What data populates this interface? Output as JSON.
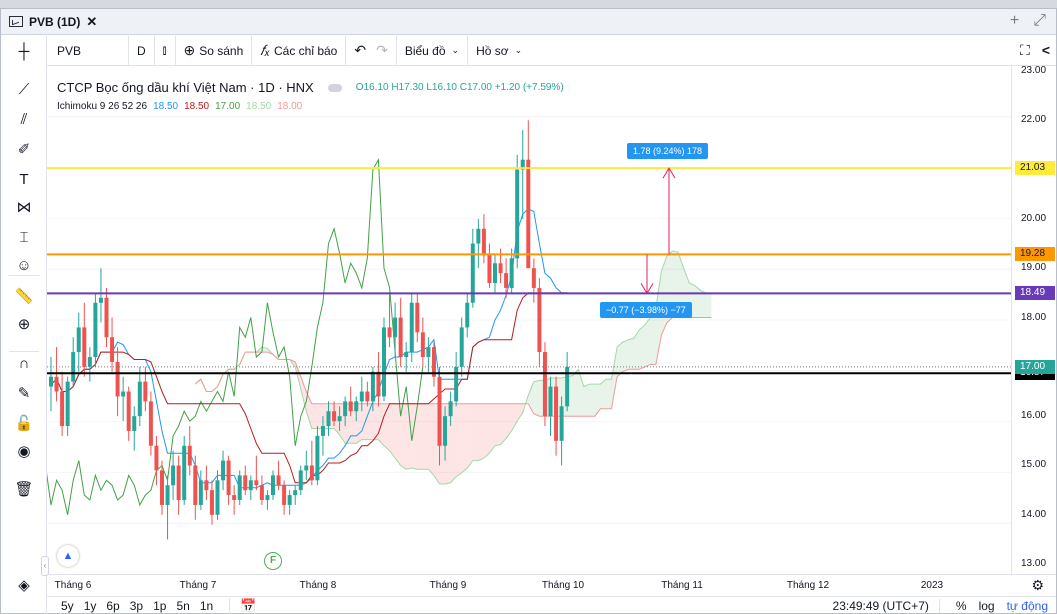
{
  "window": {
    "tab_title": "PVB (1D)",
    "close_glyph": "✕",
    "add_glyph": "+",
    "expand_glyph": "⤢"
  },
  "toolbar": {
    "symbol": "PVB",
    "interval": "D",
    "chart_style_glyph": "⫾",
    "compare_label": "So sánh",
    "indicators_label": "Các chỉ báo",
    "undo_glyph": "↶",
    "redo_glyph": "↷",
    "chart_label": "Biểu đồ",
    "profile_label": "Hồ sơ",
    "fullscreen_glyph": "⛶",
    "share_glyph": "<"
  },
  "legend": {
    "name": "CTCP Bọc ống dầu khí Việt Nam · 1D · HNX",
    "open": "O16.10",
    "high": "H17.30",
    "low": "L16.10",
    "close": "C17.00",
    "change": "+1.20 (+7.59%)",
    "indicator_name": "Ichimoku 9 26 52 26",
    "indicator_values": [
      {
        "text": "18.50",
        "color": "#2196f3"
      },
      {
        "text": "18.50",
        "color": "#b71c1c"
      },
      {
        "text": "17.00",
        "color": "#43a047"
      },
      {
        "text": "18.50",
        "color": "#a5d6a7"
      },
      {
        "text": "18.00",
        "color": "#ef9a9a"
      }
    ]
  },
  "drawings": {
    "hlines": [
      {
        "price": 21.03,
        "label": "21.03",
        "color": "#ffeb3b",
        "text_color": "#131722"
      },
      {
        "price": 19.28,
        "label": "19.28",
        "color": "#ff9800",
        "text_color": "#131722"
      },
      {
        "price": 18.49,
        "label": "18.49",
        "color": "#673ab7",
        "text_color": "#ffffff"
      },
      {
        "price": 16.87,
        "label": "16.87",
        "color": "#000000",
        "text_color": "#ffffff"
      }
    ],
    "current_price": {
      "price": 17.0,
      "label": "17.00",
      "color": "#26a69a"
    },
    "measure_up": {
      "label": "1.78 (9.24%) 178",
      "from": 19.28,
      "to": 21.03
    },
    "measure_down": {
      "label": "−0.77 (−3.98%) −77",
      "from": 19.28,
      "to": 18.49
    }
  },
  "price_axis": {
    "ticks": [
      "23.00",
      "22.00",
      "21.00",
      "20.00",
      "19.00",
      "18.00",
      "16.00",
      "15.00",
      "14.00",
      "13.00"
    ]
  },
  "time_axis": {
    "ticks": [
      "Tháng 6",
      "Tháng 7",
      "Tháng 8",
      "Tháng 9",
      "Tháng 10",
      "Tháng 11",
      "Tháng 12",
      "2023"
    ]
  },
  "bottom": {
    "ranges": [
      "5y",
      "1y",
      "6p",
      "3p",
      "1p",
      "5n",
      "1n"
    ],
    "clock": "23:49:49 (UTC+7)",
    "percent": "%",
    "log": "log",
    "auto": "tự động",
    "settings_glyph": "⚙"
  },
  "markers": {
    "earnings": "F"
  },
  "colors": {
    "up": "#26a69a",
    "down": "#ef5350",
    "accent": "#2962ff"
  },
  "left_tools": [
    {
      "name": "crosshair-icon",
      "glyph": "┼"
    },
    {
      "name": "trend-line-icon",
      "glyph": "⟋"
    },
    {
      "name": "fib-icon",
      "glyph": "⫽"
    },
    {
      "name": "brush-icon",
      "glyph": "✐"
    },
    {
      "name": "text-icon",
      "glyph": "T"
    },
    {
      "name": "pattern-icon",
      "glyph": "⋈"
    },
    {
      "name": "measure-tool-icon",
      "glyph": "⌶"
    },
    {
      "name": "emoji-icon",
      "glyph": "☺"
    },
    {
      "name": "ruler-icon",
      "glyph": "📏"
    },
    {
      "name": "zoom-in-icon",
      "glyph": "⊕"
    },
    {
      "name": "magnet-icon",
      "glyph": "∩"
    },
    {
      "name": "pencil-lock-icon",
      "glyph": "✎"
    },
    {
      "name": "lock-icon",
      "glyph": "🔓"
    },
    {
      "name": "eye-icon",
      "glyph": "◉"
    },
    {
      "name": "trash-icon",
      "glyph": "🗑"
    },
    {
      "name": "layers-icon",
      "glyph": "◈"
    }
  ],
  "chart_data": {
    "type": "candlestick",
    "x_ticks": [
      "Tháng 6",
      "Tháng 7",
      "Tháng 8",
      "Tháng 9",
      "Tháng 10",
      "Tháng 11",
      "Tháng 12",
      "2023"
    ],
    "ylim": [
      12.8,
      23.1
    ],
    "y_ticks": [
      13,
      14,
      15,
      16,
      18,
      19,
      20,
      21,
      22,
      23
    ],
    "candles": [
      [
        16.6,
        17.2,
        16.1,
        16.8
      ],
      [
        16.8,
        17.4,
        16.3,
        16.5
      ],
      [
        16.5,
        16.9,
        15.6,
        15.8
      ],
      [
        15.8,
        16.8,
        15.6,
        16.7
      ],
      [
        16.7,
        17.6,
        16.6,
        17.3
      ],
      [
        17.3,
        18.1,
        16.9,
        17.8
      ],
      [
        17.8,
        18.3,
        16.8,
        17.0
      ],
      [
        17.0,
        17.4,
        16.7,
        17.2
      ],
      [
        17.2,
        18.5,
        17.0,
        18.3
      ],
      [
        18.3,
        19.0,
        17.9,
        18.4
      ],
      [
        18.4,
        18.6,
        17.4,
        17.6
      ],
      [
        17.6,
        18.0,
        16.9,
        17.1
      ],
      [
        17.1,
        17.4,
        16.0,
        16.4
      ],
      [
        16.4,
        16.8,
        15.9,
        16.5
      ],
      [
        16.5,
        16.6,
        15.5,
        15.7
      ],
      [
        15.7,
        16.2,
        15.3,
        16.0
      ],
      [
        16.0,
        17.0,
        15.8,
        16.7
      ],
      [
        16.7,
        17.0,
        16.1,
        16.3
      ],
      [
        16.3,
        16.5,
        15.2,
        15.4
      ],
      [
        15.4,
        15.6,
        14.6,
        14.9
      ],
      [
        14.9,
        15.1,
        14.0,
        14.2
      ],
      [
        14.2,
        14.8,
        13.5,
        14.6
      ],
      [
        14.6,
        15.3,
        14.3,
        15.0
      ],
      [
        15.0,
        15.2,
        14.0,
        14.3
      ],
      [
        14.3,
        15.6,
        14.2,
        15.4
      ],
      [
        15.4,
        15.8,
        14.8,
        15.0
      ],
      [
        15.0,
        15.2,
        13.9,
        14.2
      ],
      [
        14.2,
        14.9,
        14.1,
        14.7
      ],
      [
        14.7,
        15.0,
        14.3,
        14.5
      ],
      [
        14.5,
        14.7,
        13.8,
        14.0
      ],
      [
        14.0,
        14.9,
        13.9,
        14.7
      ],
      [
        14.7,
        15.3,
        14.5,
        15.1
      ],
      [
        15.1,
        15.2,
        14.2,
        14.4
      ],
      [
        14.4,
        14.6,
        14.0,
        14.3
      ],
      [
        14.3,
        14.9,
        14.2,
        14.8
      ],
      [
        14.8,
        15.0,
        14.4,
        14.5
      ],
      [
        14.5,
        14.8,
        14.3,
        14.7
      ],
      [
        14.7,
        15.2,
        14.5,
        14.6
      ],
      [
        14.6,
        14.8,
        14.2,
        14.3
      ],
      [
        14.3,
        14.5,
        14.1,
        14.4
      ],
      [
        14.4,
        14.9,
        14.3,
        14.8
      ],
      [
        14.8,
        15.1,
        14.5,
        14.6
      ],
      [
        14.6,
        14.7,
        14.0,
        14.2
      ],
      [
        14.2,
        14.5,
        14.0,
        14.4
      ],
      [
        14.4,
        14.6,
        14.2,
        14.5
      ],
      [
        14.5,
        15.0,
        14.4,
        14.9
      ],
      [
        14.9,
        15.3,
        14.7,
        15.0
      ],
      [
        15.0,
        15.5,
        14.6,
        14.7
      ],
      [
        14.7,
        15.8,
        14.6,
        15.6
      ],
      [
        15.6,
        16.0,
        15.2,
        15.8
      ],
      [
        15.8,
        16.3,
        15.6,
        16.1
      ],
      [
        16.1,
        16.3,
        15.8,
        15.9
      ],
      [
        15.9,
        16.2,
        15.7,
        16.0
      ],
      [
        16.0,
        16.4,
        15.8,
        16.3
      ],
      [
        16.3,
        16.6,
        16.0,
        16.1
      ],
      [
        16.1,
        16.4,
        15.9,
        16.3
      ],
      [
        16.3,
        16.8,
        16.1,
        16.5
      ],
      [
        16.5,
        16.7,
        16.2,
        16.3
      ],
      [
        16.3,
        17.0,
        16.1,
        16.9
      ],
      [
        16.9,
        17.3,
        16.2,
        16.4
      ],
      [
        16.4,
        18.0,
        16.3,
        17.8
      ],
      [
        17.8,
        18.5,
        17.4,
        17.6
      ],
      [
        17.6,
        18.3,
        17.2,
        18.0
      ],
      [
        18.0,
        18.4,
        17.0,
        17.2
      ],
      [
        17.2,
        17.5,
        16.9,
        17.3
      ],
      [
        17.3,
        18.5,
        17.1,
        18.3
      ],
      [
        18.3,
        18.5,
        17.5,
        17.7
      ],
      [
        17.7,
        18.0,
        17.0,
        17.2
      ],
      [
        17.2,
        17.6,
        16.9,
        17.4
      ],
      [
        17.4,
        17.5,
        16.6,
        16.8
      ],
      [
        16.8,
        17.0,
        15.0,
        15.4
      ],
      [
        15.4,
        16.2,
        15.1,
        16.0
      ],
      [
        16.0,
        16.5,
        15.8,
        16.3
      ],
      [
        16.3,
        17.3,
        16.2,
        17.0
      ],
      [
        17.0,
        18.0,
        16.8,
        17.8
      ],
      [
        17.8,
        18.5,
        17.6,
        18.3
      ],
      [
        18.3,
        19.8,
        18.2,
        19.5
      ],
      [
        19.5,
        20.0,
        19.0,
        19.8
      ],
      [
        19.8,
        20.1,
        19.1,
        19.3
      ],
      [
        19.3,
        19.5,
        18.6,
        18.7
      ],
      [
        18.7,
        19.3,
        18.5,
        19.1
      ],
      [
        19.1,
        19.4,
        18.7,
        18.9
      ],
      [
        18.9,
        19.2,
        18.4,
        18.6
      ],
      [
        18.6,
        19.4,
        18.5,
        19.2
      ],
      [
        19.2,
        21.3,
        19.0,
        21.0
      ],
      [
        21.0,
        21.8,
        20.0,
        21.2
      ],
      [
        21.2,
        22.0,
        19.3,
        19.0
      ],
      [
        19.0,
        19.2,
        18.3,
        18.6
      ],
      [
        18.6,
        18.8,
        17.0,
        17.3
      ],
      [
        17.3,
        17.5,
        15.8,
        16.0
      ],
      [
        16.0,
        16.8,
        15.6,
        16.6
      ],
      [
        16.6,
        16.8,
        15.2,
        15.5
      ],
      [
        15.5,
        16.4,
        15.0,
        16.2
      ],
      [
        16.2,
        17.3,
        16.1,
        17.0
      ]
    ],
    "series": [
      {
        "name": "Ichimoku 9 26 52 26"
      }
    ]
  }
}
